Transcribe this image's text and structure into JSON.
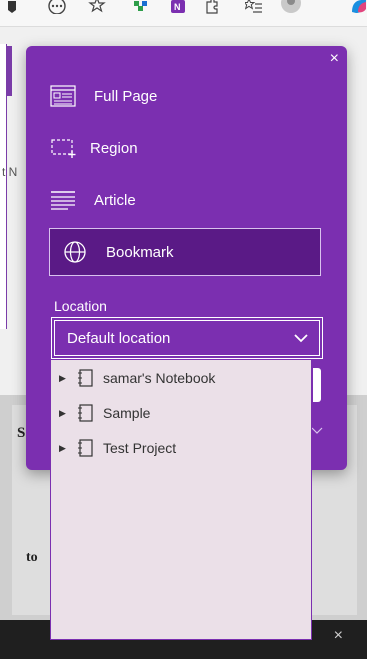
{
  "clipper": {
    "modes": [
      {
        "label": "Full Page",
        "icon": "full-page-icon"
      },
      {
        "label": "Region",
        "icon": "region-icon"
      },
      {
        "label": "Article",
        "icon": "article-icon"
      },
      {
        "label": "Bookmark",
        "icon": "globe-icon",
        "selected": true
      }
    ],
    "location_label": "Location",
    "location_value": "Default location",
    "close_glyph": "×"
  },
  "dropdown": {
    "notebooks": [
      {
        "name": "samar's Notebook"
      },
      {
        "name": "Sample"
      },
      {
        "name": "Test Project"
      }
    ]
  },
  "colors": {
    "panel": "#7b2fb0",
    "selected": "#5a1a86",
    "dropdown_bg": "#ebe0e8"
  },
  "background_page": {
    "text_s": "S",
    "text_t": "t N",
    "text_to": "to",
    "close_glyph": "×"
  }
}
